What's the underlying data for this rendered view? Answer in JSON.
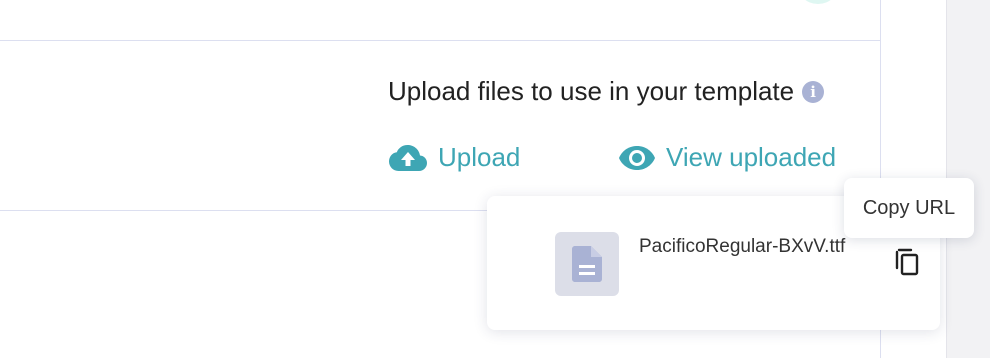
{
  "upload_section": {
    "heading": "Upload files to use in your template",
    "info_icon_glyph": "i",
    "upload_label": "Upload",
    "view_uploaded_label": "View uploaded"
  },
  "uploaded_files": {
    "items": [
      {
        "name": "PacificoRegular-BXvV.ttf",
        "icon": "file-document-icon"
      }
    ]
  },
  "tooltip": {
    "text": "Copy URL"
  },
  "colors": {
    "accent": "#3ea6b4",
    "info_icon": "#a9b2d4",
    "file_icon": "#a9b2d4",
    "divider": "#dcdff0",
    "text": "#222222"
  }
}
